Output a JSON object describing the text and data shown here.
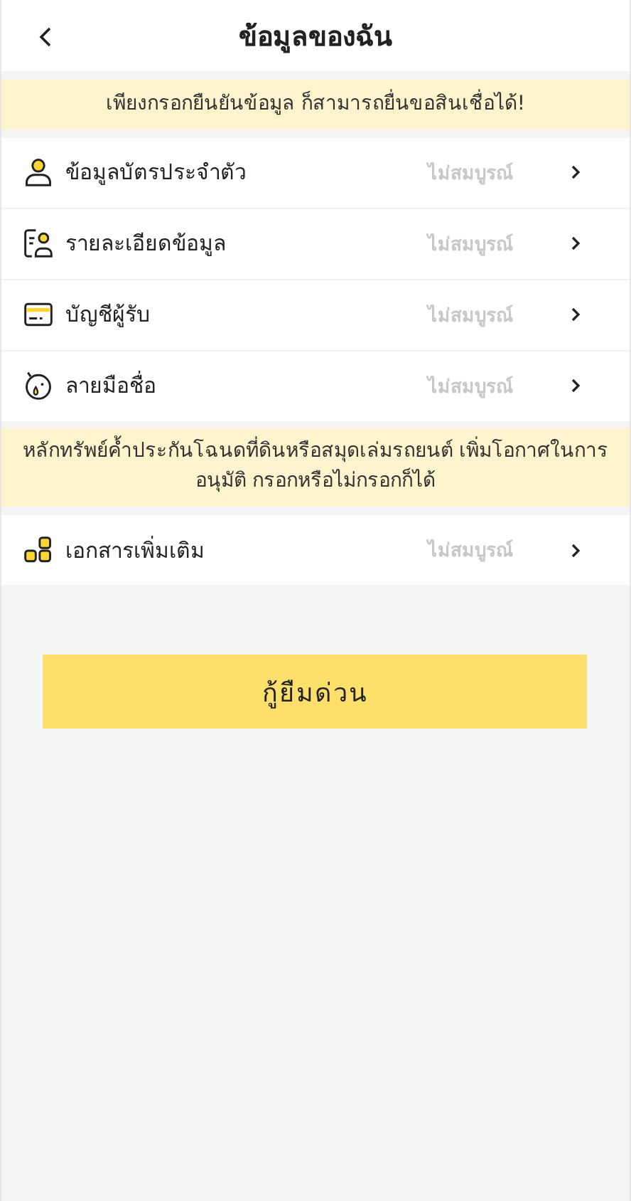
{
  "header": {
    "title": "ข้อมูลของฉัน"
  },
  "notice": "เพียงกรอกยืนยันข้อมูล ก็สามารถยื่นขอสินเชื่อได้!",
  "items": [
    {
      "label": "ข้อมูลบัตรประจำตัว",
      "status": "ไม่สมบูรณ์"
    },
    {
      "label": "รายละเอียดข้อมูล",
      "status": "ไม่สมบูรณ์"
    },
    {
      "label": "บัญชีผู้รับ",
      "status": "ไม่สมบูรณ์"
    },
    {
      "label": "ลายมือชื่อ",
      "status": "ไม่สมบูรณ์"
    }
  ],
  "optional_notice": "หลักทรัพย์ค้ำประกันโฉนดที่ดินหรือสมุดเล่มรถยนต์ เพิ่มโอกาศในการอนุมัติ กรอกหรือไม่กรอกก็ได้",
  "optional_items": [
    {
      "label": "เอกสารเพิ่มเติม",
      "status": "ไม่สมบูรณ์"
    }
  ],
  "submit_button": "กู้ยืมด่วน"
}
